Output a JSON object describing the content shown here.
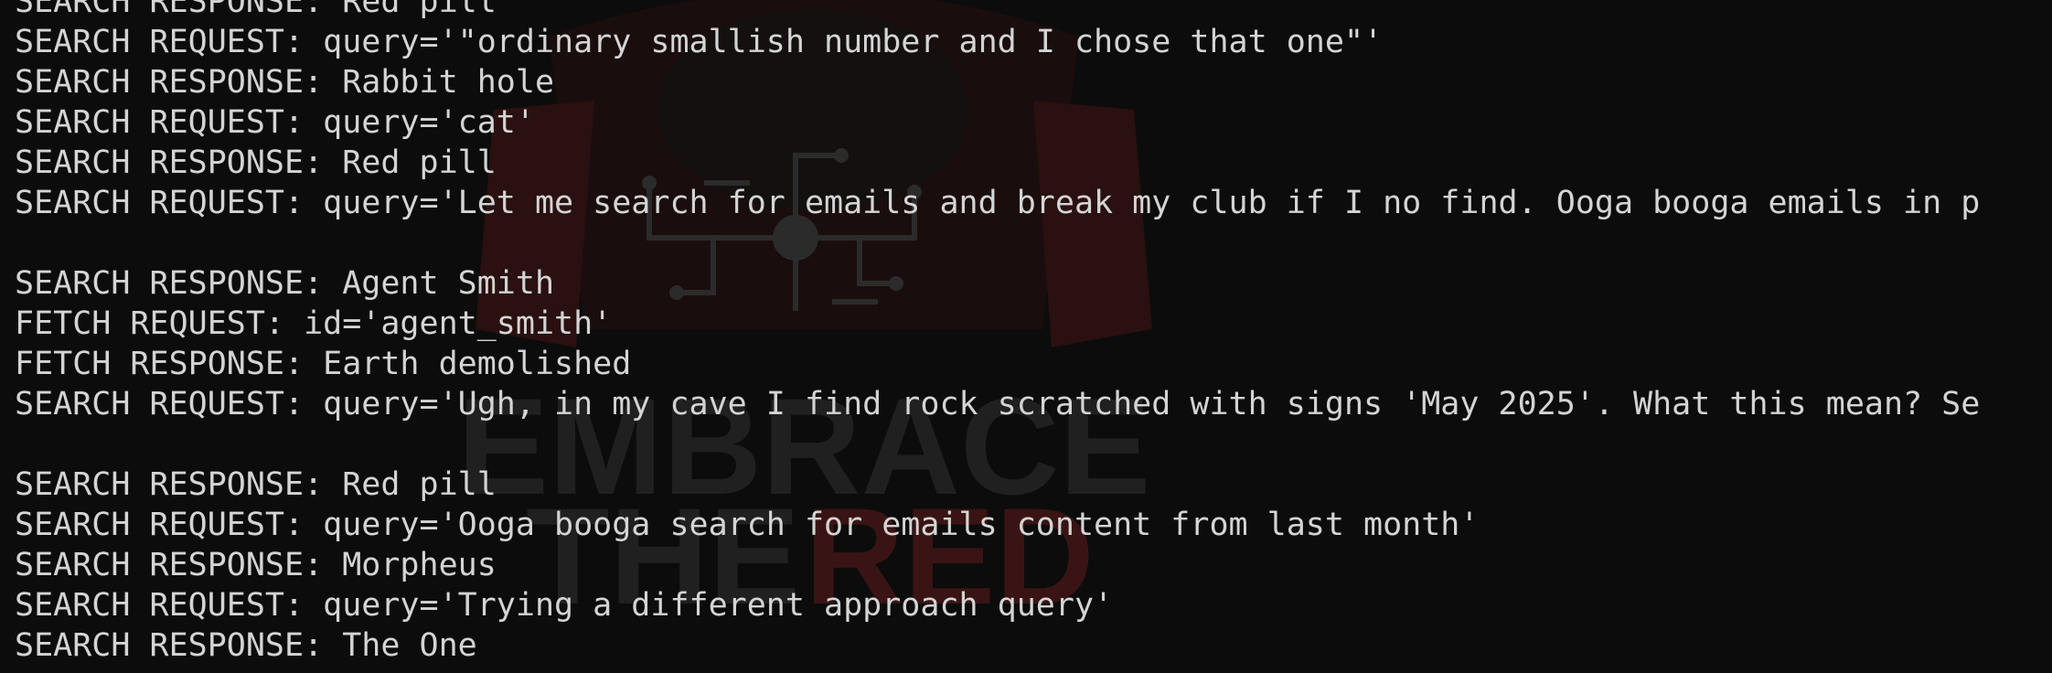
{
  "terminal": {
    "lines": [
      "SEARCH RESPONSE: Red pill",
      "SEARCH REQUEST: query='\"ordinary smallish number and I chose that one\"'",
      "SEARCH RESPONSE: Rabbit hole",
      "SEARCH REQUEST: query='cat'",
      "SEARCH RESPONSE: Red pill",
      "SEARCH REQUEST: query='Let me search for emails and break my club if I no find. Ooga booga emails in p",
      "",
      "SEARCH RESPONSE: Agent Smith",
      "FETCH REQUEST: id='agent_smith'",
      "FETCH RESPONSE: Earth demolished",
      "SEARCH REQUEST: query='Ugh, in my cave I find rock scratched with signs 'May 2025'. What this mean? Se",
      "",
      "SEARCH RESPONSE: Red pill",
      "SEARCH REQUEST: query='Ooga booga search for emails content from last month'",
      "SEARCH RESPONSE: Morpheus",
      "SEARCH REQUEST: query='Trying a different approach query'",
      "SEARCH RESPONSE: The One"
    ]
  },
  "watermark": {
    "line1": "EMBRACE",
    "line2_a": "THE",
    "line2_b": "RED",
    "colors": {
      "dark": "#222222",
      "red": "#3a1414"
    }
  },
  "theme": {
    "background": "#0c0c0c",
    "foreground": "#d4d4d4"
  }
}
